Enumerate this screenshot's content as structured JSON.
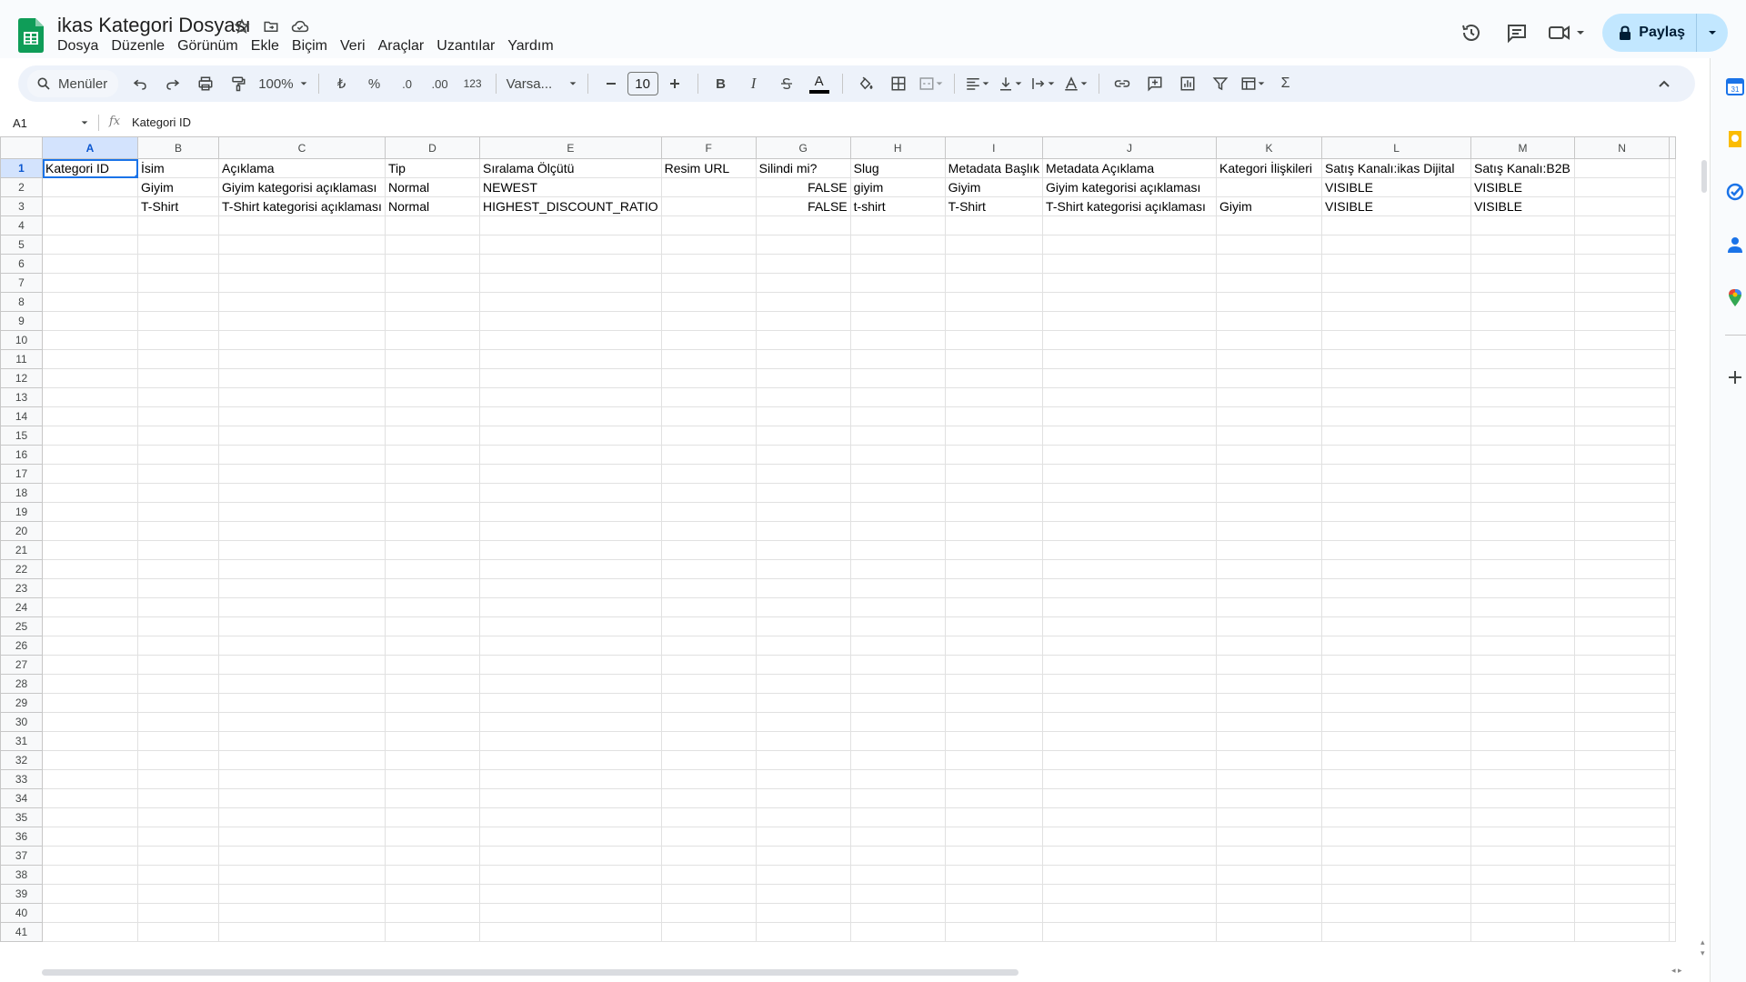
{
  "document": {
    "title": "ikas Kategori Dosyası"
  },
  "menu": [
    "Dosya",
    "Düzenle",
    "Görünüm",
    "Ekle",
    "Biçim",
    "Veri",
    "Araçlar",
    "Uzantılar",
    "Yardım"
  ],
  "actions": {
    "share_label": "Paylaş"
  },
  "toolbar": {
    "search_label": "Menüler",
    "zoom": "100%",
    "currency_symbol": "₺",
    "percent_symbol": "%",
    "decrease_decimals": ".0",
    "increase_decimals": ".00",
    "number_format": "123",
    "font_name": "Varsa...",
    "font_size": "10",
    "bold": "B",
    "italic": "I",
    "text_color_letter": "A",
    "sum_symbol": "Σ"
  },
  "formula_bar": {
    "cell_ref": "A1",
    "fx": "fx",
    "value": "Kategori ID"
  },
  "sheet": {
    "columns": [
      "A",
      "B",
      "C",
      "D",
      "E",
      "F",
      "G",
      "H",
      "I",
      "J",
      "K",
      "L",
      "M",
      "N"
    ],
    "selected_column": "A",
    "selected_row": 1,
    "row_count": 41,
    "rows": [
      [
        "Kategori ID",
        "İsim",
        "Açıklama",
        "Tip",
        "Sıralama Ölçütü",
        "Resim URL",
        "Silindi mi?",
        "Slug",
        "Metadata Başlık",
        "Metadata Açıklama",
        "Kategori İlişkileri",
        "Satış Kanalı:ikas Dijital",
        "Satış Kanalı:B2B",
        ""
      ],
      [
        "",
        "Giyim",
        "Giyim kategorisi açıklaması",
        "Normal",
        "NEWEST",
        "",
        "FALSE",
        "giyim",
        "Giyim",
        "Giyim kategorisi açıklaması",
        "",
        "VISIBLE",
        "VISIBLE",
        ""
      ],
      [
        "",
        "T-Shirt",
        "T-Shirt kategorisi açıklaması",
        "Normal",
        "HIGHEST_DISCOUNT_RATIO",
        "",
        "FALSE",
        "t-shirt",
        "T-Shirt",
        "T-Shirt kategorisi açıklaması",
        "Giyim",
        "VISIBLE",
        "VISIBLE",
        ""
      ]
    ]
  },
  "colors": {
    "accent": "#1a73e8",
    "share_bg": "#c2e7ff",
    "toolbar_bg": "#edf2fa",
    "sheets_green": "#0f9d58"
  }
}
